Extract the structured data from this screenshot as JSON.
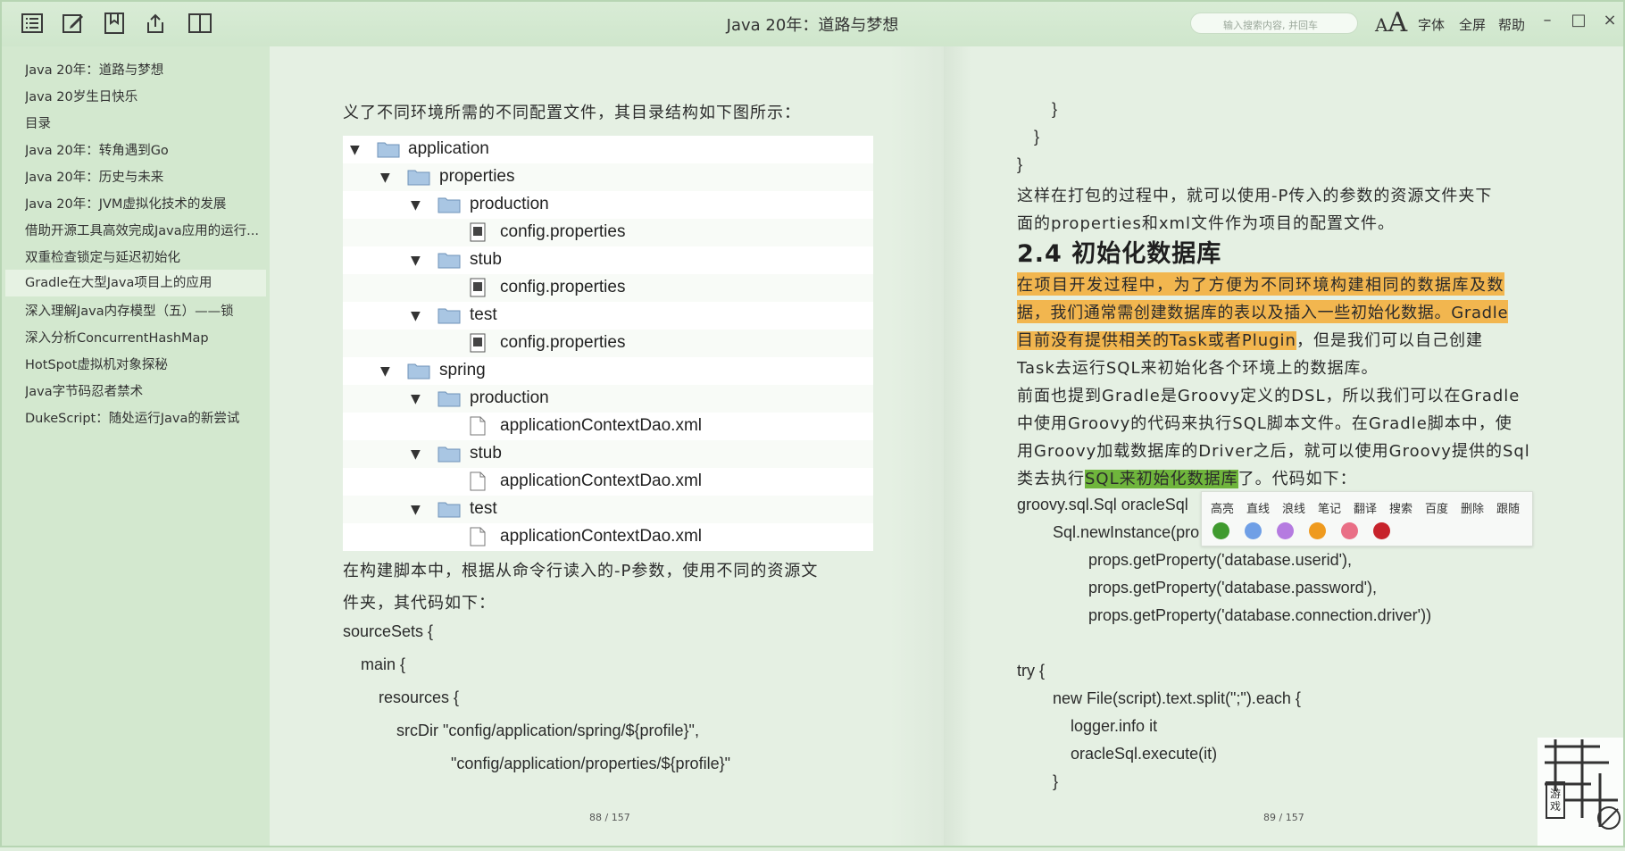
{
  "app": {
    "title": "Java 20年：道路与梦想",
    "search_placeholder": "输入搜索内容, 并回车",
    "font_size_small": "A",
    "font_size_large": "A",
    "font_label": "字体",
    "fullscreen_label": "全屏",
    "help_label": "帮助"
  },
  "toolbar_icons": [
    "toc-icon",
    "edit-icon",
    "bookmark-icon",
    "share-icon",
    "book-view-icon"
  ],
  "sidebar": {
    "items": [
      {
        "label": "Java 20年：道路与梦想"
      },
      {
        "label": "Java 20岁生日快乐"
      },
      {
        "label": "目录"
      },
      {
        "label": "Java 20年：转角遇到Go"
      },
      {
        "label": "Java 20年：历史与未来"
      },
      {
        "label": "Java 20年：JVM虚拟化技术的发展"
      },
      {
        "label": "借助开源工具高效完成Java应用的运行..."
      },
      {
        "label": "双重检查锁定与延迟初始化"
      },
      {
        "label": "Gradle在大型Java项目上的应用"
      },
      {
        "label": "深入理解Java内存模型（五）——锁"
      },
      {
        "label": "深入分析ConcurrentHashMap"
      },
      {
        "label": "HotSpot虚拟机对象探秘"
      },
      {
        "label": "Java字节码忍者禁术"
      },
      {
        "label": "DukeScript：随处运行Java的新尝试"
      }
    ],
    "active_index": 8
  },
  "left_page": {
    "intro": "义了不同环境所需的不同配置文件，其目录结构如下图所示：",
    "tree": [
      {
        "label": "application",
        "type": "folder",
        "depth": 0
      },
      {
        "label": "properties",
        "type": "folder",
        "depth": 1
      },
      {
        "label": "production",
        "type": "folder",
        "depth": 2
      },
      {
        "label": "config.properties",
        "type": "props",
        "depth": 3
      },
      {
        "label": "stub",
        "type": "folder",
        "depth": 2
      },
      {
        "label": "config.properties",
        "type": "props",
        "depth": 3
      },
      {
        "label": "test",
        "type": "folder",
        "depth": 2
      },
      {
        "label": "config.properties",
        "type": "props",
        "depth": 3
      },
      {
        "label": "spring",
        "type": "folder",
        "depth": 1
      },
      {
        "label": "production",
        "type": "folder",
        "depth": 2
      },
      {
        "label": "applicationContextDao.xml",
        "type": "file",
        "depth": 3
      },
      {
        "label": "stub",
        "type": "folder",
        "depth": 2
      },
      {
        "label": "applicationContextDao.xml",
        "type": "file",
        "depth": 3
      },
      {
        "label": "test",
        "type": "folder",
        "depth": 2
      },
      {
        "label": "applicationContextDao.xml",
        "type": "file",
        "depth": 3
      }
    ],
    "para_line1": "在构建脚本中，根据从命令行读入的-P参数，使用不同的资源文",
    "para_line2": "件夹，其代码如下：",
    "code": [
      "sourceSets {",
      "main {",
      "resources {",
      "srcDir \"config/application/spring/${profile}\",",
      "\"config/application/properties/${profile}\""
    ],
    "page_number": "88 / 157"
  },
  "right_page": {
    "close1": "}",
    "close2": "}",
    "close3": "}",
    "para1_line1": "这样在打包的过程中，就可以使用-P传入的参数的资源文件夹下",
    "para1_line2": "面的properties和xml文件作为项目的配置文件。",
    "heading": "2.4 初始化数据库",
    "hl_line1": "在项目开发过程中，为了方便为不同环境构建相同的数据库及数",
    "hl_line2": "据，我们通常需创建数据库的表以及插入一些初始化数据。Gradle",
    "hl_line3a": "目前没有提供相关的Task或者Plugin",
    "hl_line3b": "，但是我们可以自己创建",
    "line4": "Task去运行SQL来初始化各个环境上的数据库。",
    "p3_line1": "前面也提到Gradle是Groovy定义的DSL，所以我们可以在Gradle",
    "p3_line2": "中使用Groovy的代码来执行SQL脚本文件。在Gradle脚本中，使",
    "p3_line3": "用Groovy加载数据库的Driver之后，就可以使用Groovy提供的Sql",
    "p3_line4a": "类去执行",
    "p3_line4b": "SQL来初始化数据库",
    "p3_line4c": "了。代码如下：",
    "code1": "groovy.sql.Sql oracleSql",
    "code2": "Sql.newInstance(pro",
    "code3": "props.getProperty('database.userid'),",
    "code4": "props.getProperty('database.password'),",
    "code5": "props.getProperty('database.connection.driver'))",
    "code6": "try {",
    "code7": "new File(script).text.split(\";\").each {",
    "code8": "logger.info it",
    "code9": "oracleSql.execute(it)",
    "code10": "}",
    "page_number": "89 / 157"
  },
  "popup": {
    "actions": [
      "高亮",
      "直线",
      "浪线",
      "笔记",
      "翻译",
      "搜索",
      "百度",
      "删除",
      "跟随"
    ],
    "colors": [
      "#3f9a2e",
      "#6f9fe6",
      "#b57be0",
      "#ef9a1e",
      "#e96f86",
      "#c7232b"
    ]
  },
  "colors": {
    "highlight_orange": "#f2b64f",
    "highlight_green": "#6fb53c"
  },
  "watermark_text": "游戏"
}
